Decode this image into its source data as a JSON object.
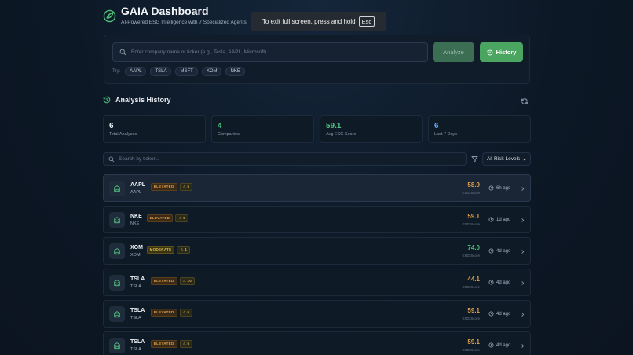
{
  "header": {
    "title": "GAIA Dashboard",
    "subtitle": "AI-Powered ESG Intelligence with 7 Specialized Agents"
  },
  "fullscreen_notice": {
    "text": "To exit full screen, press and hold",
    "key": "Esc"
  },
  "search": {
    "placeholder": "Enter company name or ticker (e.g., Tesla, AAPL, Microsoft)...",
    "analyze_label": "Analyze",
    "history_label": "History",
    "try_label": "Try:",
    "suggestions": [
      "AAPL",
      "TSLA",
      "MSFT",
      "XOM",
      "NKE"
    ]
  },
  "history": {
    "title": "Analysis History",
    "stats": [
      {
        "value": "6",
        "label": "Total Analyses",
        "color": "#e6edf3"
      },
      {
        "value": "4",
        "label": "Companies",
        "color": "#4ec07a"
      },
      {
        "value": "59.1",
        "label": "Avg ESG Score",
        "color": "#4ec07a"
      },
      {
        "value": "6",
        "label": "Last 7 Days",
        "color": "#5aa8f0"
      }
    ],
    "filter_placeholder": "Search by ticker...",
    "risk_filter": "All Risk Levels",
    "score_label": "ESG Score",
    "rows": [
      {
        "ticker": "AAPL",
        "name": "AAPL",
        "risk": "ELEVATED",
        "alerts": "5",
        "score": "58.9",
        "score_color": "#e0a04a",
        "time": "6h ago"
      },
      {
        "ticker": "NKE",
        "name": "NKE",
        "risk": "ELEVATED",
        "alerts": "5",
        "score": "59.1",
        "score_color": "#e0a04a",
        "time": "1d ago"
      },
      {
        "ticker": "XOM",
        "name": "XOM",
        "risk": "MODERATE",
        "alerts": "1",
        "score": "74.0",
        "score_color": "#4ec07a",
        "time": "4d ago"
      },
      {
        "ticker": "TSLA",
        "name": "TSLA",
        "risk": "ELEVATED",
        "alerts": "10",
        "score": "44.1",
        "score_color": "#e0a04a",
        "time": "4d ago"
      },
      {
        "ticker": "TSLA",
        "name": "TSLA",
        "risk": "ELEVATED",
        "alerts": "5",
        "score": "59.1",
        "score_color": "#e0a04a",
        "time": "4d ago"
      },
      {
        "ticker": "TSLA",
        "name": "TSLA",
        "risk": "ELEVATED",
        "alerts": "5",
        "score": "59.1",
        "score_color": "#e0a04a",
        "time": "4d ago"
      }
    ]
  }
}
